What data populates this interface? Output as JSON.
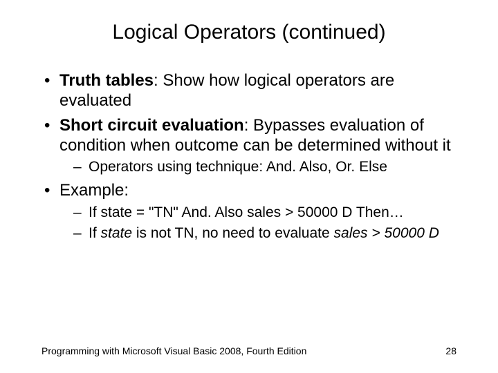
{
  "title": "Logical Operators (continued)",
  "bullets": {
    "b1_bold": "Truth tables",
    "b1_rest": ": Show how logical operators are evaluated",
    "b2_bold": "Short circuit evaluation",
    "b2_rest": ": Bypasses evaluation of condition when outcome can be determined without it",
    "b2_sub1": "Operators using technique: And. Also, Or. Else",
    "b3": "Example:",
    "b3_sub1": "If state = \"TN\" And. Also sales > 50000 D Then…",
    "b3_sub2_a": "If ",
    "b3_sub2_state": "state",
    "b3_sub2_b": " is not TN, no need to evaluate ",
    "b3_sub2_sales": "sales > 50000 D"
  },
  "footer": {
    "left": "Programming with Microsoft Visual Basic 2008, Fourth Edition",
    "right": "28"
  }
}
